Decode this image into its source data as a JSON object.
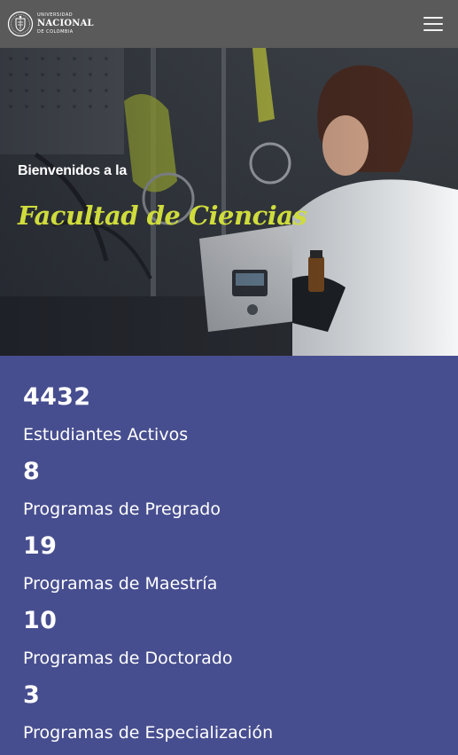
{
  "header": {
    "logo": {
      "line1": "UNIVERSIDAD",
      "line2": "NACIONAL",
      "line3": "DE COLOMBIA"
    },
    "menu_icon": "hamburger-menu-icon"
  },
  "hero": {
    "welcome": "Bienvenidos a la",
    "title": "Facultad de Ciencias",
    "title_color": "#cfdc3c"
  },
  "stats": {
    "background": "#474e8f",
    "items": [
      {
        "value": "4432",
        "label": "Estudiantes Activos"
      },
      {
        "value": "8",
        "label": "Programas de Pregrado"
      },
      {
        "value": "19",
        "label": "Programas de Maestría"
      },
      {
        "value": "10",
        "label": "Programas de Doctorado"
      },
      {
        "value": "3",
        "label": "Programas de Especialización"
      }
    ]
  }
}
